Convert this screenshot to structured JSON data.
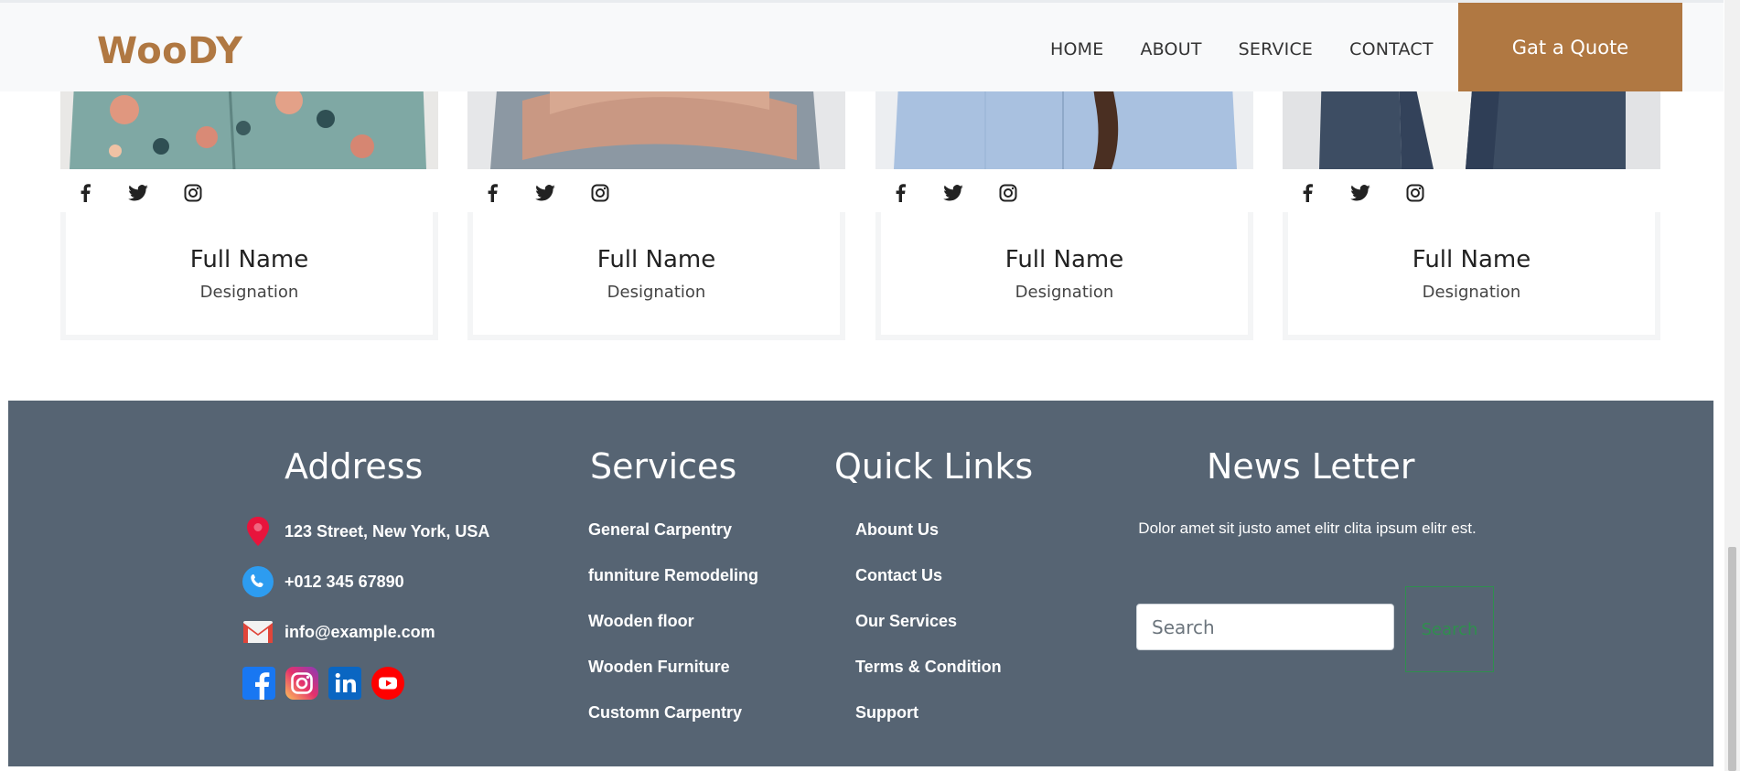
{
  "header": {
    "logo": "WooDY",
    "nav": [
      "HOME",
      "ABOUT",
      "SERVICE",
      "CONTACT"
    ],
    "cta": "Gat a Quote",
    "brand_color": "#b07842"
  },
  "team": {
    "members": [
      {
        "name": "Full Name",
        "designation": "Designation",
        "socials": [
          "facebook-icon",
          "twitter-icon",
          "instagram-icon"
        ]
      },
      {
        "name": "Full Name",
        "designation": "Designation",
        "socials": [
          "facebook-icon",
          "twitter-icon",
          "instagram-icon"
        ]
      },
      {
        "name": "Full Name",
        "designation": "Designation",
        "socials": [
          "facebook-icon",
          "twitter-icon",
          "instagram-icon"
        ]
      },
      {
        "name": "Full Name",
        "designation": "Designation",
        "socials": [
          "facebook-icon",
          "twitter-icon",
          "instagram-icon"
        ]
      }
    ]
  },
  "footer": {
    "background": "#566473",
    "address": {
      "title": "Address",
      "street": "123 Street, New York, USA",
      "phone": "+012 345 67890",
      "email": "info@example.com",
      "socials": [
        "facebook-icon",
        "instagram-icon",
        "linkedin-icon",
        "youtube-icon"
      ]
    },
    "services": {
      "title": "Services",
      "links": [
        "General Carpentry",
        "funniture Remodeling",
        "Wooden floor",
        "Wooden Furniture",
        "Customn Carpentry"
      ]
    },
    "quick_links": {
      "title": "Quick Links",
      "links": [
        "Abount Us",
        "Contact Us",
        "Our Services",
        "Terms & Condition",
        "Support"
      ]
    },
    "newsletter": {
      "title": "News Letter",
      "text": "Dolor amet sit justo amet elitr clita ipsum elitr est.",
      "placeholder": "Search",
      "button": "Search"
    }
  }
}
